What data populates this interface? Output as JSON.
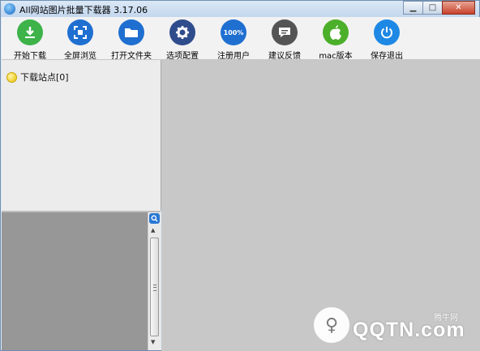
{
  "window": {
    "title": "All网站图片批量下载器 3.17.06",
    "minimize_glyph": "▁",
    "maximize_glyph": "□",
    "close_glyph": "✕"
  },
  "toolbar": {
    "buttons": [
      {
        "label": "开始下载",
        "icon": "download-icon",
        "color": "#3db34a"
      },
      {
        "label": "全屏浏览",
        "icon": "fullscreen-icon",
        "color": "#1f6fd1"
      },
      {
        "label": "打开文件夹",
        "icon": "folder-icon",
        "color": "#1f6fd1"
      },
      {
        "label": "选项配置",
        "icon": "gear-icon",
        "color": "#2f4d8c"
      },
      {
        "label": "注册用户",
        "icon": "register-icon",
        "icon_text": "100%",
        "color": "#1f6fd1"
      },
      {
        "label": "建议反馈",
        "icon": "feedback-icon",
        "color": "#555555"
      },
      {
        "label": "mac版本",
        "icon": "apple-icon",
        "color": "#4caf2a"
      },
      {
        "label": "保存退出",
        "icon": "power-icon",
        "color": "#1e88e5"
      }
    ]
  },
  "sidebar": {
    "tree_root_label": "下载站点[0]"
  },
  "watermark": {
    "text": "QQTN.com",
    "small_text": "腾牛网"
  }
}
